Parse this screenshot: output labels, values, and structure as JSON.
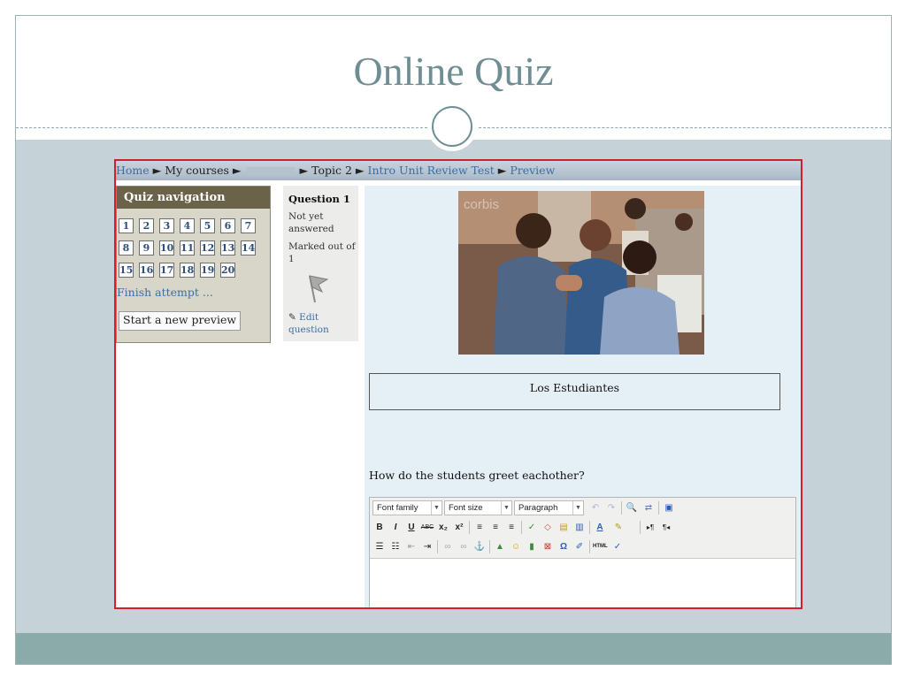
{
  "slide": {
    "title": "Online Quiz",
    "colors": {
      "accent": "#6e8e94",
      "background": "#c5d2d8",
      "footer": "#8aabaa",
      "frame": "#d0202a"
    }
  },
  "breadcrumb": {
    "home": "Home",
    "sep1": "►",
    "my_courses": "My courses",
    "sep2": "►",
    "sep3": "►",
    "topic": "Topic 2",
    "sep4": "►",
    "test": "Intro Unit Review Test",
    "sep5": "►",
    "preview": "Preview"
  },
  "quiz_nav": {
    "header": "Quiz navigation",
    "questions": [
      "1",
      "2",
      "3",
      "4",
      "5",
      "6",
      "7",
      "8",
      "9",
      "10",
      "11",
      "12",
      "13",
      "14",
      "15",
      "16",
      "17",
      "18",
      "19",
      "20"
    ],
    "finish_label": "Finish attempt ...",
    "new_preview_label": "Start a new preview"
  },
  "question_info": {
    "number_label": "Question",
    "number": "1",
    "state": "Not yet answered",
    "marked": "Marked out of 1",
    "edit_label": "Edit question"
  },
  "content": {
    "image_watermark": "corbis",
    "answer_box_text": "Los Estudiantes",
    "question_text": "How do the students greet eachother?"
  },
  "editor": {
    "font_family": "Font family",
    "font_size": "Font size",
    "paragraph": "Paragraph"
  }
}
